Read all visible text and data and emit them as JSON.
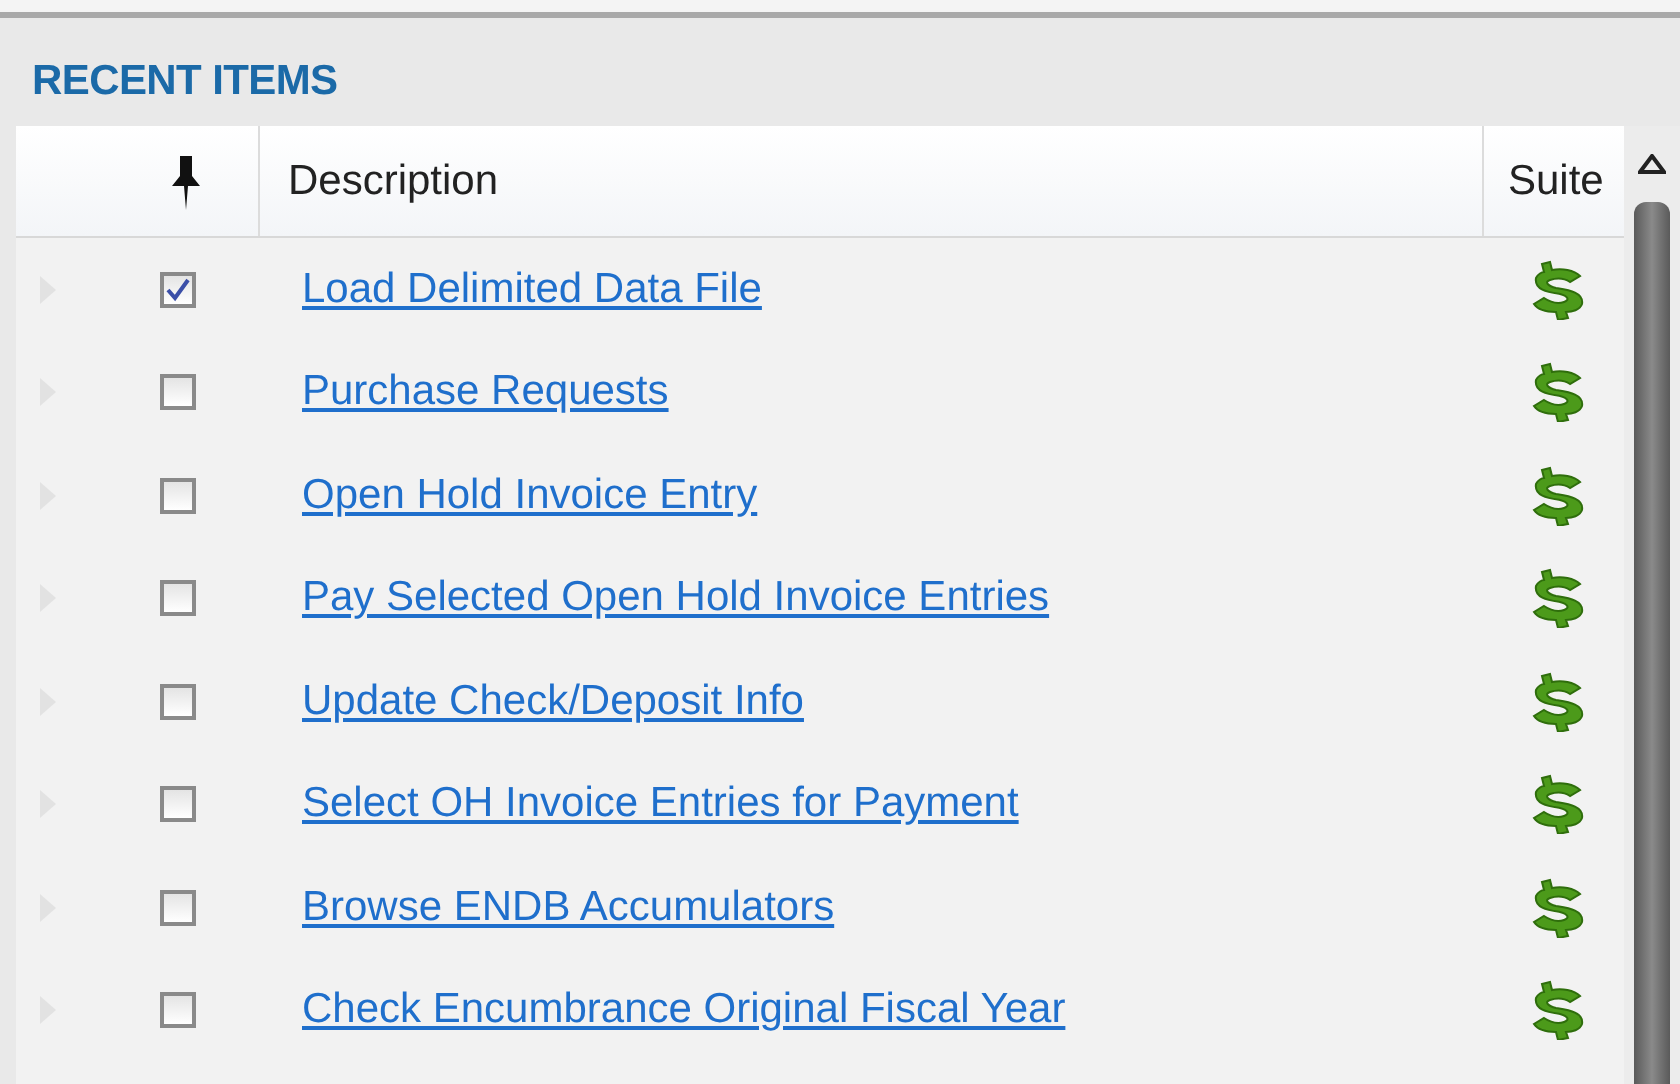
{
  "panel": {
    "title": "RECENT ITEMS"
  },
  "table": {
    "columns": [
      "Description",
      "Suite"
    ],
    "rows": [
      {
        "checked": true,
        "description": "Load Delimited Data File"
      },
      {
        "checked": false,
        "description": "Purchase Requests"
      },
      {
        "checked": false,
        "description": "Open Hold Invoice Entry"
      },
      {
        "checked": false,
        "description": "Pay Selected Open Hold Invoice Entries"
      },
      {
        "checked": false,
        "description": "Update Check/Deposit Info"
      },
      {
        "checked": false,
        "description": "Select OH Invoice Entries for Payment"
      },
      {
        "checked": false,
        "description": "Browse ENDB Accumulators"
      },
      {
        "checked": false,
        "description": "Check Encumbrance Original Fiscal Year"
      }
    ]
  }
}
